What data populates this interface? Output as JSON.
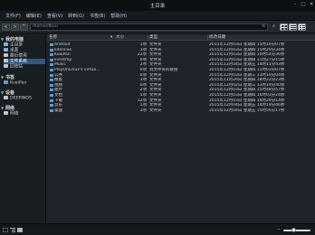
{
  "window": {
    "title": "主目录",
    "controls": [
      "–",
      "□",
      "✕"
    ]
  },
  "menubar": [
    "文件(F)",
    "编辑(E)",
    "查看(V)",
    "转到(G)",
    "书签(B)",
    "帮助(H)"
  ],
  "toolbar": {
    "back_label": "<",
    "forward_label": ">",
    "up_label": "^",
    "path_value": "/home/dbuu",
    "go_label": "⟲",
    "search_label": "⌕"
  },
  "sidebar": {
    "sections": [
      {
        "header": "我的电脑",
        "items": [
          {
            "label": "主目录",
            "icon": "home-icon",
            "color": "#7fb3e6",
            "selected": false
          },
          {
            "label": "桌面",
            "icon": "desktop-icon",
            "color": "#7fb3e6",
            "selected": false
          },
          {
            "label": "最近使用",
            "icon": "recent-icon",
            "color": "#c3c7cb",
            "selected": false
          },
          {
            "label": "文件系统",
            "icon": "drive-icon",
            "color": "#c3c7cb",
            "selected": true
          },
          {
            "label": "回收站",
            "icon": "trash-icon",
            "color": "#c3c7cb",
            "selected": false
          }
        ]
      },
      {
        "header": "书签",
        "items": [
          {
            "label": "KuaiPan",
            "icon": "folder-icon",
            "color": "#5aa0dc",
            "selected": false
          }
        ]
      },
      {
        "header": "设备",
        "items": [
          {
            "label": "DEEPINOS",
            "icon": "disk-icon",
            "color": "#c3c7cb",
            "selected": false
          }
        ]
      },
      {
        "header": "网络",
        "items": [
          {
            "label": "网络",
            "icon": "network-icon",
            "color": "#c3c7cb",
            "selected": false
          }
        ]
      }
    ]
  },
  "file_list": {
    "columns": {
      "name": "名称",
      "size": "大小",
      "type": "类型",
      "date": "修改日期"
    },
    "rows": [
      {
        "name": "Android",
        "size": "1项",
        "type": "文件夹",
        "date": "2015年12月03日 星期四 15时16分07秒"
      },
      {
        "name": "kdenlive",
        "size": "3项",
        "type": "文件夹",
        "date": "2015年12月03日 星期四 15时29分34秒"
      },
      {
        "name": "KuaiPan",
        "size": "22项",
        "type": "文件夹",
        "date": "2015年12月03日 星期四 10时54分36秒"
      },
      {
        "name": "livestmp",
        "size": "0项",
        "type": "文件夹",
        "date": "2015年12月03日 星期四 11时27分15秒"
      },
      {
        "name": "Music",
        "size": "2项",
        "type": "文件夹",
        "date": "2015年12月04日 星期五 14时11分43秒"
      },
      {
        "name": "PlayOnLinux's virtua…",
        "size": "0项",
        "type": "到文件夹的链接",
        "date": "2015年12月03日 星期四 11时03分07秒"
      },
      {
        "name": "公共",
        "size": "0项",
        "type": "文件夹",
        "date": "2015年12月03日 星期三 13时19分04秒"
      },
      {
        "name": "模板",
        "size": "3项",
        "type": "文件夹",
        "date": "2015年11月26日 星期四 18时22分23秒"
      },
      {
        "name": "视频",
        "size": "0项",
        "type": "文件夹",
        "date": "2015年12月02日 星期三 13时19分40秒"
      },
      {
        "name": "图片",
        "size": "2项",
        "type": "文件夹",
        "date": "2015年12月03日 星期四 15时48分57秒"
      },
      {
        "name": "文档",
        "size": "5项",
        "type": "文件夹",
        "date": "2015年12月03日 星期四 16时03分24秒"
      },
      {
        "name": "下载",
        "size": "12项",
        "type": "文件夹",
        "date": "2015年12月03日 星期四 16时29分14秒"
      },
      {
        "name": "音乐",
        "size": "1项",
        "type": "文件夹",
        "date": "2015年12月04日 星期五 14时19分46秒"
      },
      {
        "name": "桌面",
        "size": "3项",
        "type": "文件夹",
        "date": "2015年12月04日 星期五 15时56分17秒"
      }
    ]
  },
  "status": {
    "zoom_fraction": 0.35
  }
}
